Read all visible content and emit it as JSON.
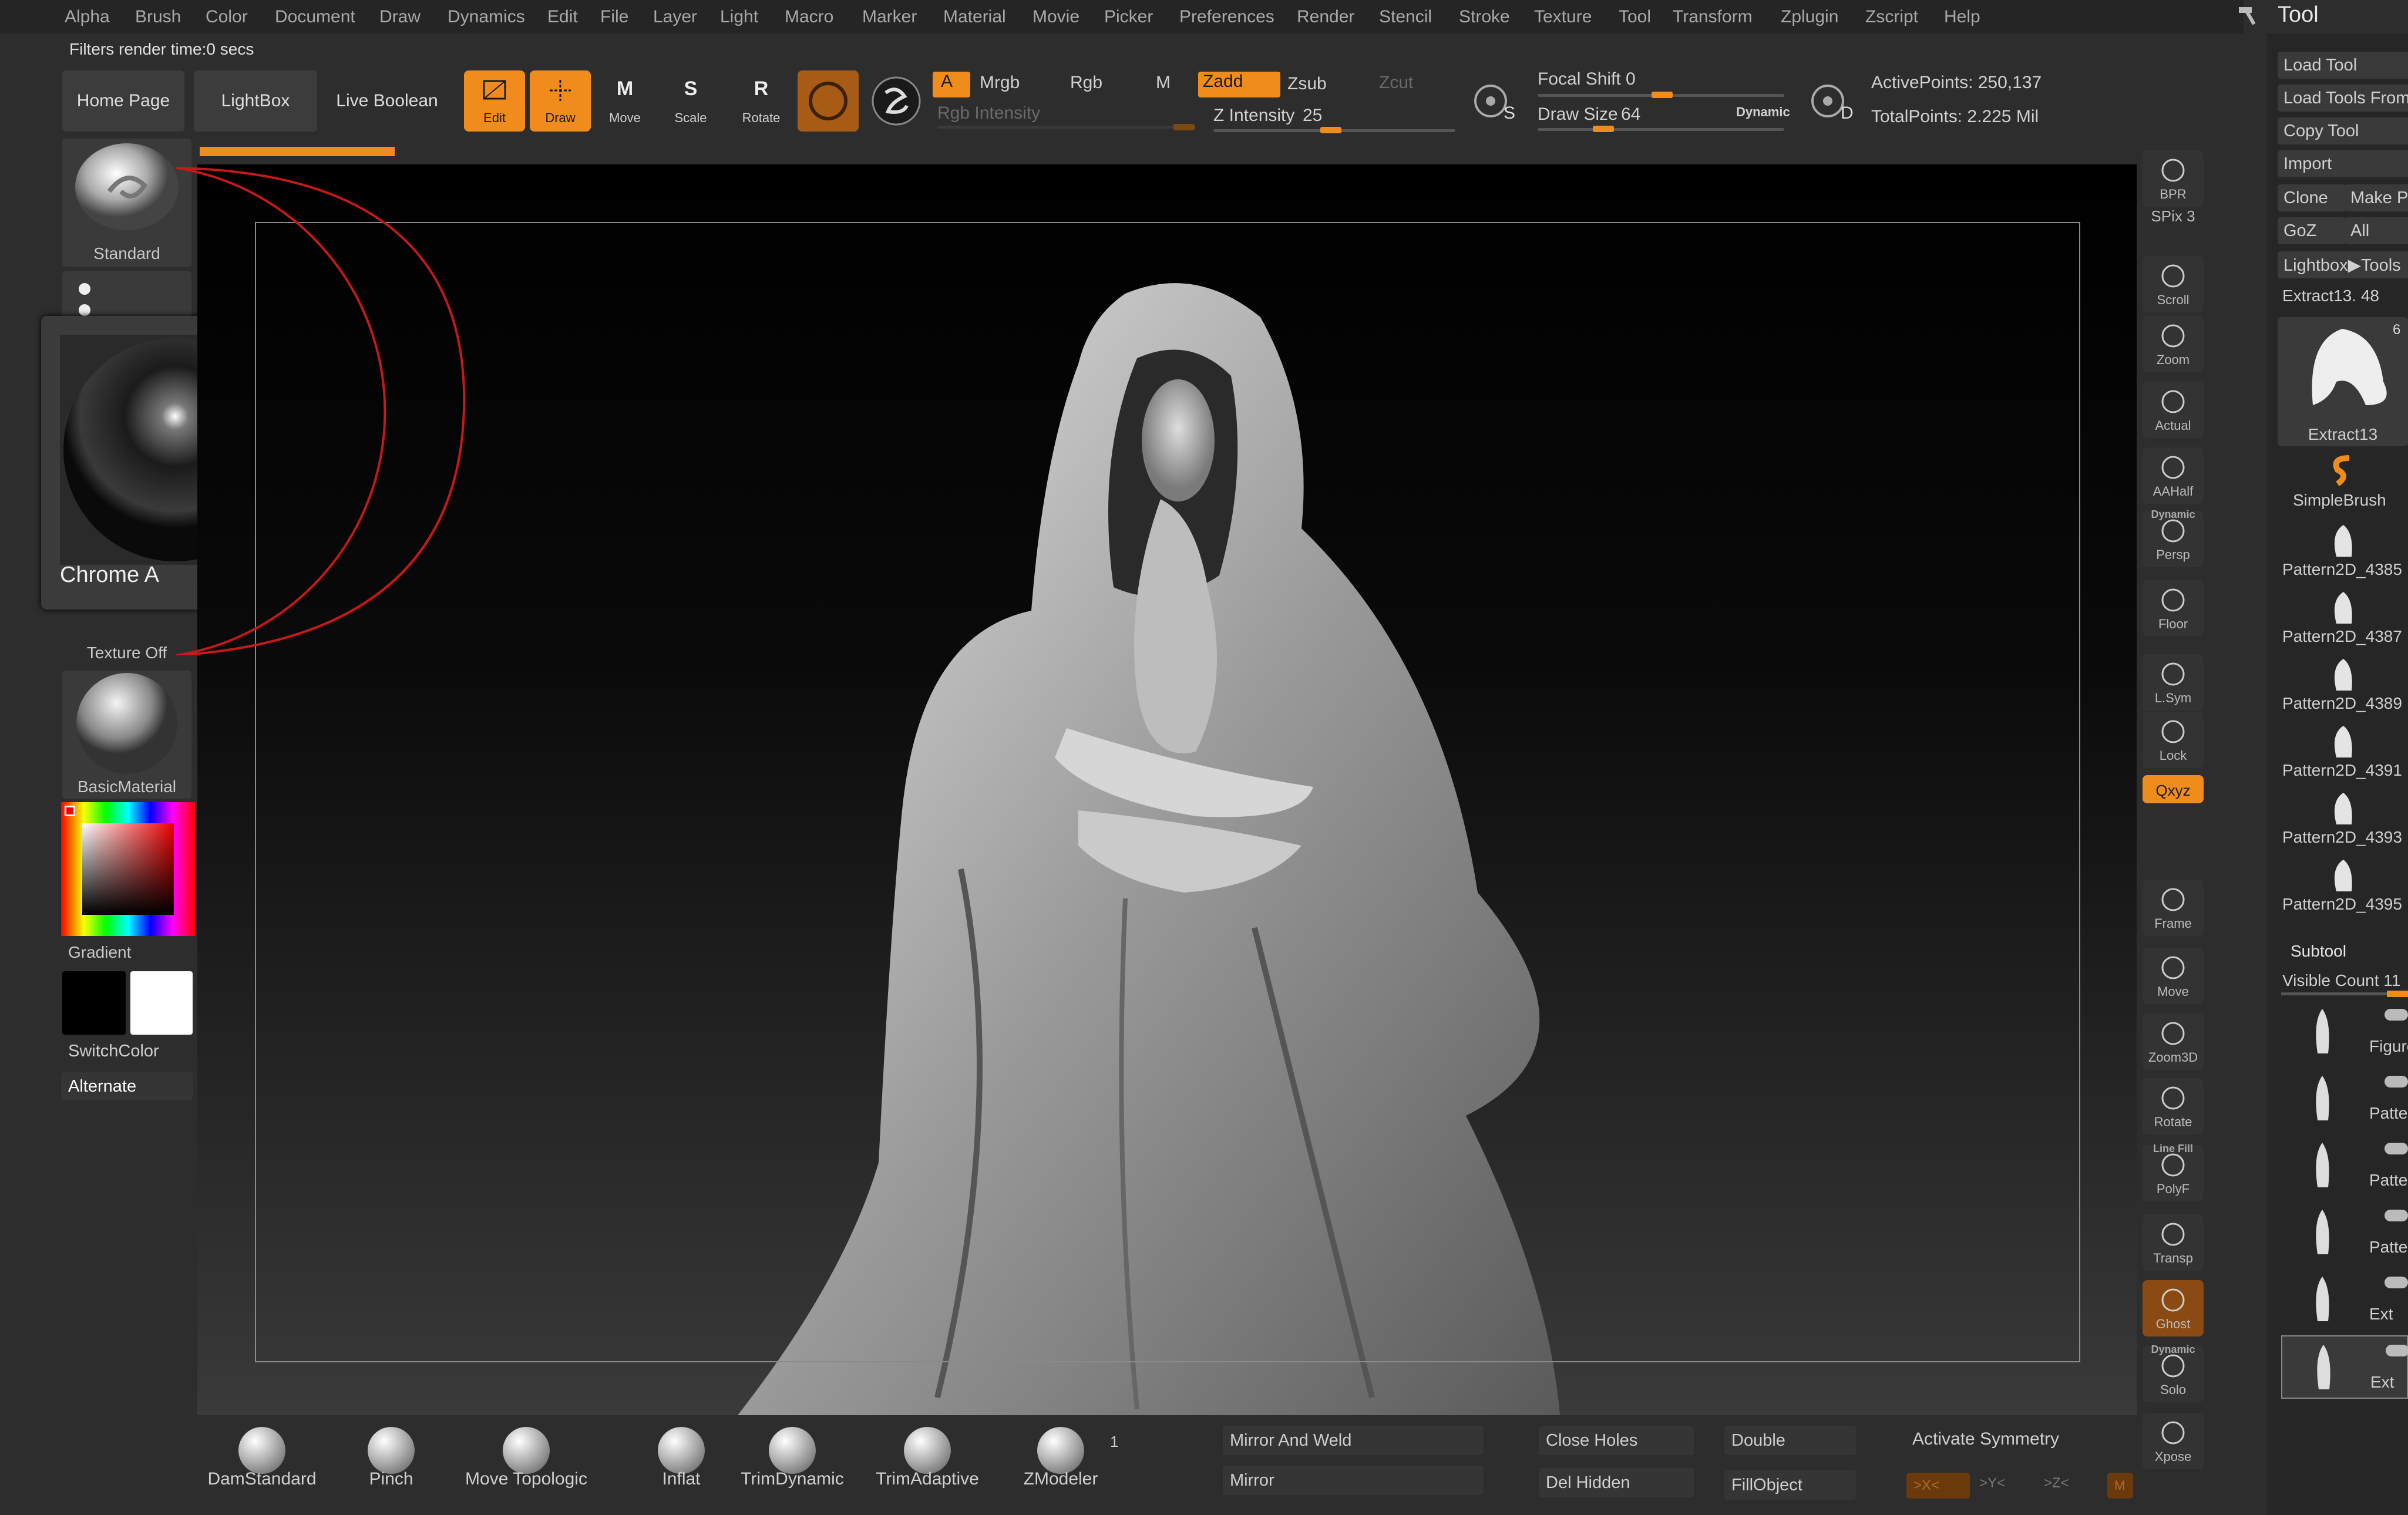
{
  "menu": [
    "Alpha",
    "Brush",
    "Color",
    "Document",
    "Draw",
    "Dynamics",
    "Edit",
    "File",
    "Layer",
    "Light",
    "Macro",
    "Marker",
    "Material",
    "Movie",
    "Picker",
    "Preferences",
    "Render",
    "Stencil",
    "Stroke",
    "Texture",
    "Tool",
    "Transform",
    "Zplugin",
    "Zscript",
    "Help"
  ],
  "status_text": "Filters render time:0 secs",
  "nav_tabs": [
    "Home Page",
    "LightBox",
    "Live Boolean"
  ],
  "tools": [
    {
      "label": "Edit",
      "active": true
    },
    {
      "label": "Draw",
      "active": true
    },
    {
      "label": "Move",
      "active": false,
      "key": "M"
    },
    {
      "label": "Scale",
      "active": false,
      "key": "S"
    },
    {
      "label": "Rotate",
      "active": false,
      "key": "R"
    }
  ],
  "color_modes": {
    "a": "A",
    "mrgb": "Mrgb",
    "rgb": "Rgb",
    "m": "M",
    "rgb_intensity": "Rgb Intensity"
  },
  "sculpt_modes": {
    "zadd": "Zadd",
    "zsub": "Zsub",
    "zcut": "Zcut",
    "z_intensity_label": "Z Intensity",
    "z_intensity_value": "25"
  },
  "draw_settings": {
    "focal_shift_label": "Focal Shift",
    "focal_shift_value": "0",
    "draw_size_label": "Draw Size",
    "draw_size_value": "64",
    "dynamic": "Dynamic",
    "s_key": "S",
    "d_key": "D"
  },
  "stats": {
    "active_points": "ActivePoints: 250,137",
    "total_points": "TotalPoints: 2.225 Mil"
  },
  "left_panel": {
    "brush_label": "Standard",
    "material_popup": "Chrome A",
    "texture_label": "Texture Off",
    "material_label": "BasicMaterial",
    "gradient_label": "Gradient",
    "switchcolor_label": "SwitchColor",
    "alternate_label": "Alternate"
  },
  "right_shelf": [
    {
      "label": "BPR"
    },
    {
      "label": "SPix 3"
    },
    {
      "label": "Scroll"
    },
    {
      "label": "Zoom"
    },
    {
      "label": "Actual"
    },
    {
      "label": "AAHalf"
    },
    {
      "label": "Persp",
      "top": "Dynamic"
    },
    {
      "label": "Floor"
    },
    {
      "label": "L.Sym"
    },
    {
      "label": "Lock"
    },
    {
      "label": "Qxyz"
    },
    {
      "label": "Frame"
    },
    {
      "label": "Move"
    },
    {
      "label": "Zoom3D"
    },
    {
      "label": "Rotate"
    },
    {
      "label": "PolyF",
      "top": "Line Fill"
    },
    {
      "label": "Transp"
    },
    {
      "label": "Ghost"
    },
    {
      "label": "Solo",
      "top": "Dynamic"
    },
    {
      "label": "Xpose"
    }
  ],
  "tool_palette": {
    "title": "Tool",
    "load_tool": "Load Tool",
    "load_tools_from": "Load Tools From",
    "copy_tool": "Copy Tool",
    "import": "Import",
    "clone": "Clone",
    "make_p": "Make P",
    "goz": "GoZ",
    "all": "All",
    "lightbox_tools": "Lightbox▶Tools",
    "current_tool": "Extract13. 48",
    "current_tool_thumb": "Extract13",
    "current_tool_count": "6",
    "simplebrush": "SimpleBrush",
    "tools": [
      "Pattern2D_4385",
      "Pattern2D_4387",
      "Pattern2D_4389",
      "Pattern2D_4391",
      "Pattern2D_4393",
      "Pattern2D_4395"
    ],
    "subtool_title": "Subtool",
    "visible_count": "Visible Count 11",
    "subtools": [
      "Figure",
      "Patter",
      "Patter",
      "Patter",
      "Ext",
      "Ext"
    ]
  },
  "bottom_brushes": [
    "DamStandard",
    "Pinch",
    "Move Topologic",
    "Inflat",
    "TrimDynamic",
    "TrimAdaptive",
    "ZModeler"
  ],
  "zmodeler_count": "1",
  "bottom_buttons": {
    "mirror_weld": "Mirror And Weld",
    "mirror": "Mirror",
    "close_holes": "Close Holes",
    "del_hidden": "Del Hidden",
    "double": "Double",
    "fill_object": "FillObject",
    "activate_symmetry": "Activate Symmetry",
    "sym_x": ">X<",
    "sym_y": ">Y<",
    "sym_z": ">Z<",
    "sym_m": "M"
  },
  "colors": {
    "accent": "#f08c1c",
    "panel": "#2d2d2d"
  }
}
